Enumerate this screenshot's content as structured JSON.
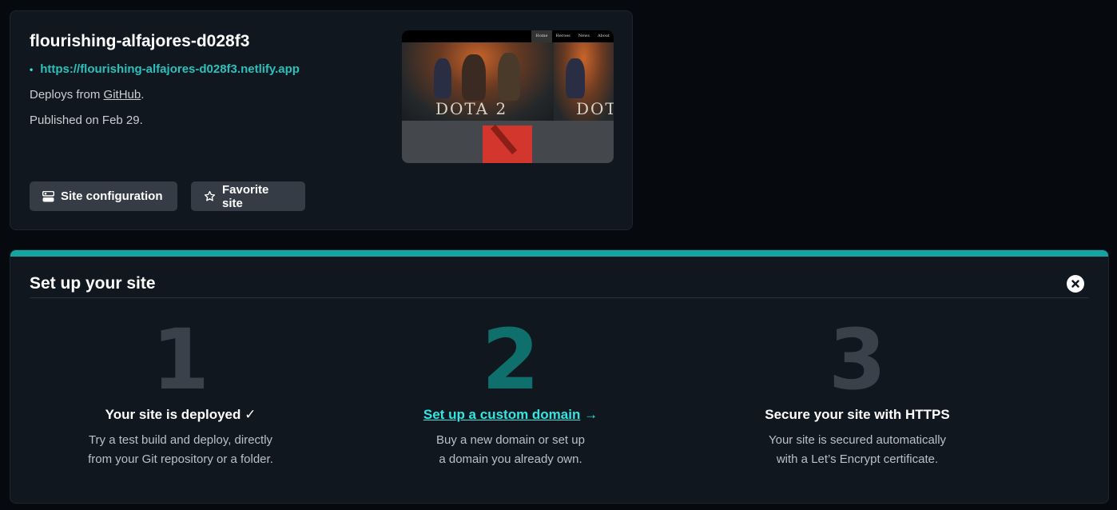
{
  "site": {
    "name": "flourishing-alfajores-d028f3",
    "url_bullet": "•",
    "url": "https://flourishing-alfajores-d028f3.netlify.app",
    "deploys_prefix": "Deploys from ",
    "deploys_source": "GitHub",
    "deploys_suffix": ".",
    "published": "Published on Feb 29.",
    "preview": {
      "nav": [
        "Home",
        "Heroes",
        "News",
        "About"
      ],
      "title": "DOTA 2",
      "title_repeat": "DOT"
    },
    "buttons": {
      "config_label": "Site configuration",
      "config_icon": "settings-icon",
      "favorite_label": "Favorite site",
      "favorite_icon": "star-icon"
    }
  },
  "setup": {
    "title": "Set up your site",
    "close_icon": "close-icon",
    "accent_color": "#14a5a2",
    "steps": [
      {
        "number": "1",
        "heading": "Your site is deployed ✓",
        "desc_line1": "Try a test build and deploy, directly",
        "desc_line2": "from your Git repository or a folder."
      },
      {
        "number": "2",
        "heading_link": "Set up a custom domain",
        "heading_arrow": " →",
        "desc_line1": "Buy a new domain or set up",
        "desc_line2": "a domain you already own."
      },
      {
        "number": "3",
        "heading": "Secure your site with HTTPS",
        "desc_line1": "Your site is secured automatically",
        "desc_line2": "with a Let’s Encrypt certificate."
      }
    ]
  }
}
